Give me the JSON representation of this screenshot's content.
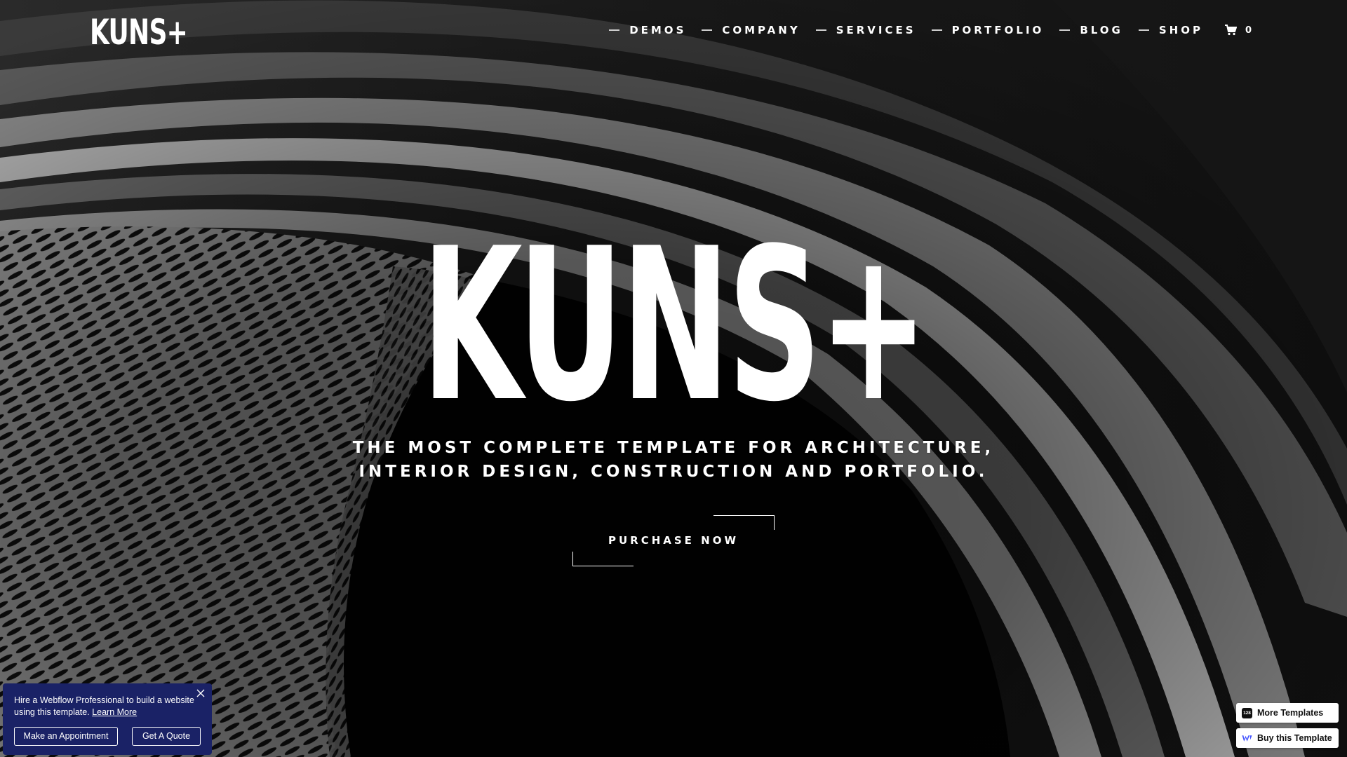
{
  "brand": {
    "logo_text": "KUNS+"
  },
  "nav": {
    "items": [
      {
        "label": "DEMOS"
      },
      {
        "label": "COMPANY"
      },
      {
        "label": "SERVICES"
      },
      {
        "label": "PORTFOLIO"
      },
      {
        "label": "BLOG"
      },
      {
        "label": "SHOP"
      }
    ],
    "cart_count": "0"
  },
  "hero": {
    "title": "KUNS+",
    "subtitle_line1": "THE MOST COMPLETE TEMPLATE FOR ARCHITECTURE,",
    "subtitle_line2": "INTERIOR DESIGN, CONSTRUCTION AND PORTFOLIO.",
    "cta_label": "PURCHASE NOW"
  },
  "hire_popup": {
    "text": "Hire a Webflow Professional to build a website using this template.",
    "link_label": "Learn More",
    "button_primary": "Make an Appointment",
    "button_secondary": "Get A Quote",
    "background_color": "#1a2266"
  },
  "badges": {
    "more_templates_count": "128",
    "more_templates_label": "More Templates",
    "buy_label": "Buy this Template"
  },
  "colors": {
    "text": "#ffffff",
    "background": "#050505",
    "webflow_blue": "#4353ff"
  },
  "icons": {
    "cart": "cart-icon",
    "close": "close-icon",
    "webflow": "webflow-logo-icon"
  }
}
